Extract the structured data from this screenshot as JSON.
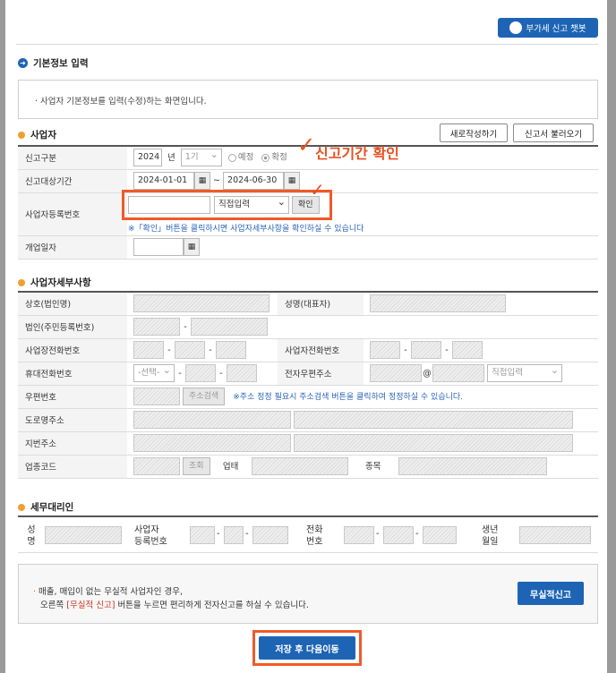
{
  "chatbot_label": "부가세 신고 챗봇",
  "section_basic": {
    "title": "기본정보 입력",
    "info": "사업자 기본정보를 입력(수정)하는 화면입니다."
  },
  "section_business": {
    "title": "사업자",
    "new_button": "새로작성하기",
    "load_button": "신고서 불러오기",
    "report_type_label": "신고구분",
    "year": "2024",
    "year_suffix": "년",
    "period": "1기",
    "radio_estimate": "예정",
    "radio_final": "확정",
    "period_label": "신고대상기간",
    "date_from": "2024-01-01",
    "date_to": "2024-06-30",
    "tilde": "~",
    "reg_no_label": "사업자등록번호",
    "reg_no_select": "직접입력",
    "confirm_button": "확인",
    "reg_no_note": "※「확인」버튼을 클릭하시면 사업자세부사항을 확인하실 수 있습니다",
    "open_date_label": "개업일자"
  },
  "annotation": {
    "check": "✓",
    "text": "신고기간 확인",
    "check2": "✓"
  },
  "section_details": {
    "title": "사업자세부사항",
    "trade_name": "상호(법인명)",
    "rep_name": "성명(대표자)",
    "corp_no": "법인(주민등록번호)",
    "biz_phone": "사업장전화번호",
    "biz_owner_phone": "사업자전화번호",
    "mobile": "휴대전화번호",
    "mobile_select": "-선택-",
    "email": "전자우편주소",
    "at": "@",
    "email_select": "직접입력",
    "zip": "우편번호",
    "addr_search": "주소검색",
    "addr_note": "※주소 정정 필요시 주소검색 버튼을 클릭하여 정정하실 수 있습니다.",
    "road_addr": "도로명주소",
    "lot_addr": "지번주소",
    "industry_code": "업종코드",
    "lookup": "조회",
    "business_type": "업태",
    "business_item": "종목",
    "dash": "-"
  },
  "section_agent": {
    "title": "세무대리인",
    "name_l1": "성",
    "name_l2": "명",
    "reg_l1": "사업자",
    "reg_l2": "등록번호",
    "phone_l1": "전화",
    "phone_l2": "번호",
    "birth_l1": "생년",
    "birth_l2": "월일"
  },
  "bottom": {
    "line1": "매출, 매입이 없는 무실적 사업자인 경우,",
    "line2_pre": "오른쪽",
    "line2_red": "[무실적 신고]",
    "line2_post": "버튼을 누르면 편리하게 전자신고를 하실 수 있습니다.",
    "zero_button": "무실적신고",
    "save_next": "저장 후 다음이동"
  }
}
